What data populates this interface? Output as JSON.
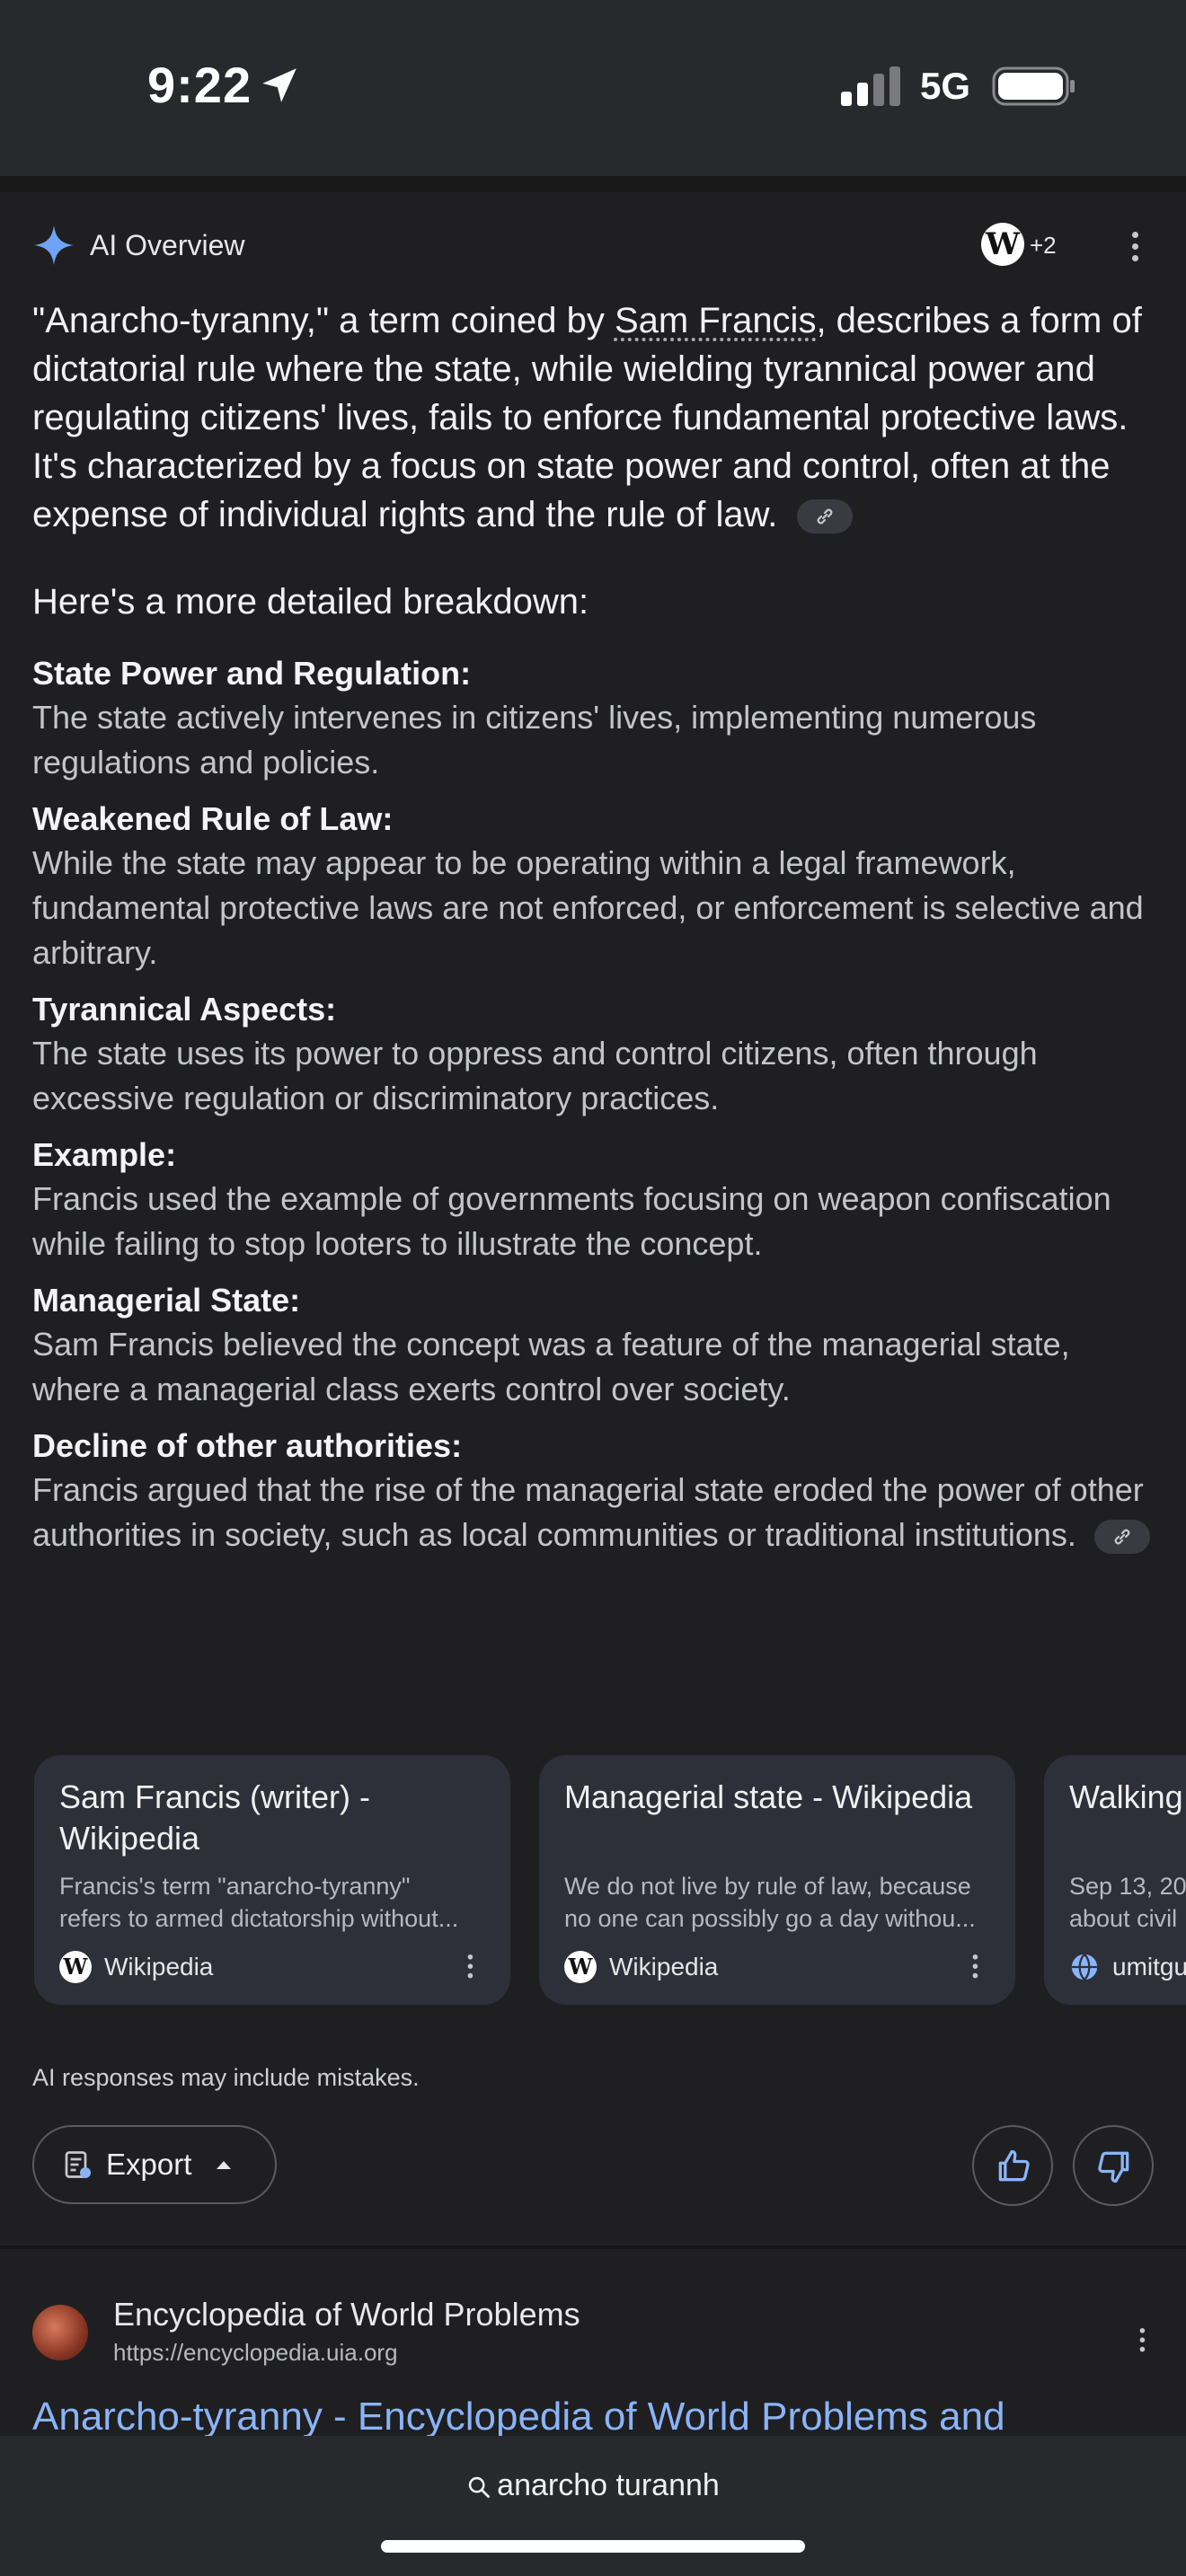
{
  "status_bar": {
    "time": "9:22",
    "network": "5G"
  },
  "ai_overview": {
    "label": "AI Overview",
    "source_count": "+2",
    "intro_before": "\"Anarcho-tyranny,\" a term coined by ",
    "intro_link": "Sam Francis",
    "intro_after": ", describes a form of dictatorial rule where the state, while wielding tyrannical power and regulating citizens' lives, fails to enforce fundamental protective laws. It's characterized by a focus on state power and control, often at the expense of individual rights and the rule of law.",
    "breakdown_heading": "Here's a more detailed breakdown:",
    "items": [
      {
        "title": "State Power and Regulation:",
        "body": "The state actively intervenes in citizens' lives, implementing numerous regulations and policies."
      },
      {
        "title": "Weakened Rule of Law:",
        "body": "While the state may appear to be operating within a legal framework, fundamental protective laws are not enforced, or enforcement is selective and arbitrary."
      },
      {
        "title": "Tyrannical Aspects:",
        "body": "The state uses its power to oppress and control citizens, often through excessive regulation or discriminatory practices."
      },
      {
        "title": "Example:",
        "body": "Francis used the example of governments focusing on weapon confiscation while failing to stop looters to illustrate the concept."
      },
      {
        "title": "Managerial State:",
        "body": "Sam Francis believed the concept was a feature of the managerial state, where a managerial class exerts control over society."
      },
      {
        "title": "Decline of other authorities:",
        "body": "Francis argued that the rise of the managerial state eroded the power of other authorities in society, such as local communities or traditional institutions."
      }
    ],
    "sources": [
      {
        "title": "Sam Francis (writer) - Wikipedia",
        "snippet_1": "Francis's term \"anarcho-tyranny\"",
        "snippet_2": "refers to armed dictatorship without...",
        "site": "Wikipedia",
        "icon": "wikipedia-icon"
      },
      {
        "title": "Managerial state - Wikipedia",
        "snippet_1": "We do not live by rule of law, because",
        "snippet_2": "no one can possibly go a day withou...",
        "site": "Wikipedia",
        "icon": "wikipedia-icon"
      },
      {
        "title": "Walking The Fra",
        "snippet_1": "Sep 13, 20",
        "snippet_2": "about civil",
        "site": "umitgu",
        "icon": "globe-icon"
      }
    ],
    "disclaimer": "AI responses may include mistakes.",
    "export_label": "Export"
  },
  "search_result": {
    "site_name": "Encyclopedia of World Problems",
    "url": "https://encyclopedia.uia.org",
    "title": "Anarcho-tyranny - Encyclopedia of World Problems and"
  },
  "search_bar": {
    "query": "anarcho turannh"
  },
  "colors": {
    "background": "#1f1f21",
    "link": "#8ab4f8",
    "card": "#2e3039",
    "accent_sparkle": "#6fa3f7"
  }
}
